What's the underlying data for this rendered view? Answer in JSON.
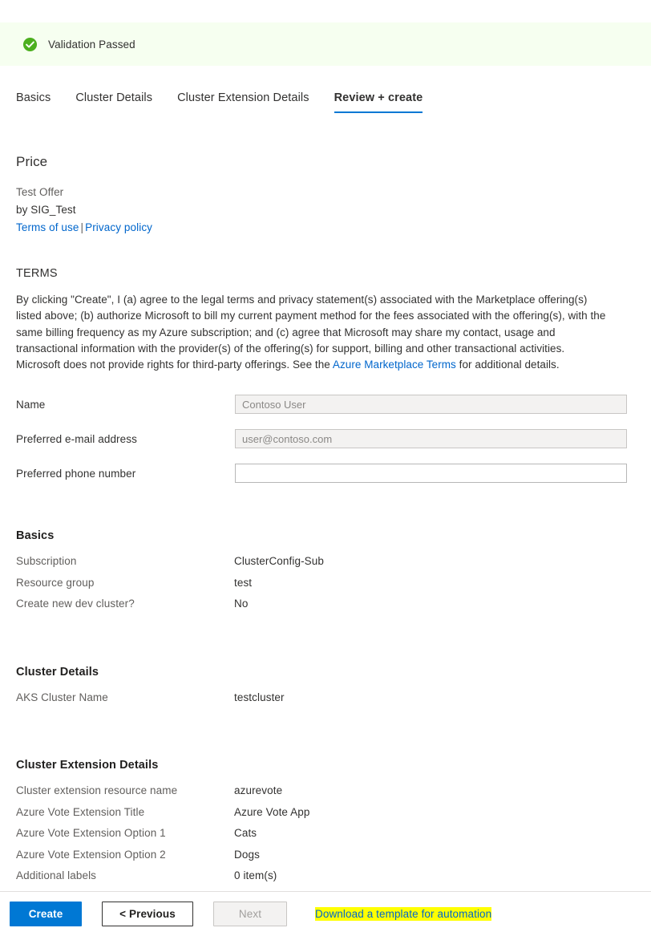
{
  "validation": {
    "icon": "check-circle-icon",
    "message": "Validation Passed",
    "banner_bg": "#f6fff0",
    "icon_color": "#4caf1f"
  },
  "tabs": [
    {
      "label": "Basics",
      "active": false
    },
    {
      "label": "Cluster Details",
      "active": false
    },
    {
      "label": "Cluster Extension Details",
      "active": false
    },
    {
      "label": "Review + create",
      "active": true
    }
  ],
  "accent_color": "#0078d4",
  "link_color": "#0066cc",
  "price": {
    "heading": "Price",
    "offer": "Test Offer",
    "publisher": "by SIG_Test",
    "terms_of_use_link": "Terms of use",
    "separator": "|",
    "privacy_policy_link": "Privacy policy"
  },
  "terms": {
    "heading": "TERMS",
    "body_part_1": "By clicking \"Create\", I (a) agree to the legal terms and privacy statement(s) associated with the Marketplace offering(s) listed above; (b) authorize Microsoft to bill my current payment method for the fees associated with the offering(s), with the same billing frequency as my Azure subscription; and (c) agree that Microsoft may share my contact, usage and transactional information with the provider(s) of the offering(s) for support, billing and other transactional activities. Microsoft does not provide rights for third-party offerings. See the ",
    "marketplace_terms_link": "Azure Marketplace Terms",
    "body_part_2": " for additional details."
  },
  "form": {
    "name": {
      "label": "Name",
      "value": "Contoso User",
      "placeholder": "Contoso User",
      "disabled": true
    },
    "email": {
      "label": "Preferred e-mail address",
      "value": "user@contoso.com",
      "placeholder": "user@contoso.com",
      "disabled": true
    },
    "phone": {
      "label": "Preferred phone number",
      "value": "",
      "placeholder": "",
      "disabled": false
    }
  },
  "summary": [
    {
      "title": "Basics",
      "rows": [
        {
          "key": "Subscription",
          "value": "ClusterConfig-Sub"
        },
        {
          "key": "Resource group",
          "value": "test"
        },
        {
          "key": "Create new dev cluster?",
          "value": "No"
        }
      ]
    },
    {
      "title": "Cluster Details",
      "rows": [
        {
          "key": "AKS Cluster Name",
          "value": "testcluster"
        }
      ]
    },
    {
      "title": "Cluster Extension Details",
      "rows": [
        {
          "key": "Cluster extension resource name",
          "value": "azurevote"
        },
        {
          "key": "Azure Vote Extension Title",
          "value": "Azure Vote App"
        },
        {
          "key": "Azure Vote Extension Option 1",
          "value": "Cats"
        },
        {
          "key": "Azure Vote Extension Option 2",
          "value": "Dogs"
        },
        {
          "key": "Additional labels",
          "value": "0 item(s)"
        }
      ]
    }
  ],
  "footer": {
    "create_label": "Create",
    "previous_label": "< Previous",
    "next_label": "Next",
    "download_template_label": "Download a template for automation",
    "highlight_color": "#ffff00"
  }
}
